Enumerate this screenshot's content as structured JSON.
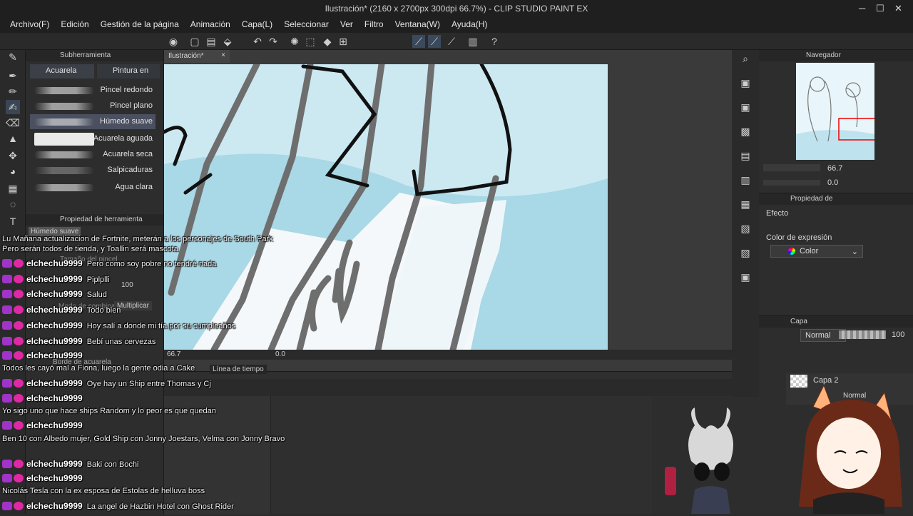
{
  "window": {
    "title": "Ilustración* (2160 x 2700px 300dpi 66.7%)  - CLIP STUDIO PAINT EX",
    "minimize": "─",
    "maximize": "☐",
    "close": "✕"
  },
  "menu": [
    "Archivo(F)",
    "Edición",
    "Gestión de la página",
    "Animación",
    "Capa(L)",
    "Seleccionar",
    "Ver",
    "Filtro",
    "Ventana(W)",
    "Ayuda(H)"
  ],
  "subtool": {
    "header": "Subherramienta",
    "tabs": [
      "Acuarela",
      "Pintura en"
    ],
    "brushes": [
      {
        "label": "Pincel redondo",
        "selected": false
      },
      {
        "label": "Pincel plano",
        "selected": false
      },
      {
        "label": "Húmedo suave",
        "selected": true
      },
      {
        "label": "Acuarela aguada",
        "selected": false
      },
      {
        "label": "Acuarela seca",
        "selected": false
      },
      {
        "label": "Salpicaduras",
        "selected": false
      },
      {
        "label": "Agua clara",
        "selected": false
      }
    ],
    "tool_property_header": "Propiedad de herramienta",
    "tool_property_name": "Húmedo suave",
    "brush_size_label": "Tamaño del pincel",
    "opacity_value": "100",
    "blend_mode_label": "Modo de combinación",
    "blend_mode_value": "Multiplicar",
    "border_label": "Borde de acuarela"
  },
  "document": {
    "tab_label": "Ilustración*",
    "tab_close": "×",
    "zoom": "66.7",
    "rotation": "0.0"
  },
  "timeline": {
    "label": "Línea de tiempo"
  },
  "navigator": {
    "header": "Navegador",
    "zoom": "66.7",
    "rotation": "0.0"
  },
  "property": {
    "header": "Propiedad de",
    "effect_label": "Efecto",
    "expression_color_label": "Color de expresión",
    "expression_color_value": "Color"
  },
  "layers": {
    "header": "Capa",
    "blend": "Normal",
    "opacity": "100",
    "items": [
      {
        "name": "Capa 2",
        "mode": ""
      },
      {
        "name": "",
        "mode": "Normal"
      }
    ]
  },
  "chat": [
    {
      "user": "",
      "text": "Lu Mañana actualizacion de Fortnite, meterán a los personajes de South Park Pero serán todos de tienda, y Toallin será mascota",
      "wrap": true
    },
    {
      "user": "elchechu9999",
      "text": "Pero como soy pobre no tendré nada"
    },
    {
      "user": "elchechu9999",
      "text": "Piplplli"
    },
    {
      "user": "elchechu9999",
      "text": "Salud"
    },
    {
      "user": "elchechu9999",
      "text": "Todo bien"
    },
    {
      "user": "elchechu9999",
      "text": "Hoy salí a donde mi tía por su cumpleaños"
    },
    {
      "user": "elchechu9999",
      "text": "Bebí unas cervezas"
    },
    {
      "user": "elchechu9999",
      "text": ""
    },
    {
      "user": "",
      "text": "Todos les cayó mal a Fiona, luego la gente odia a Cake"
    },
    {
      "user": "elchechu9999",
      "text": "Oye hay un Ship entre Thomas y Cj"
    },
    {
      "user": "elchechu9999",
      "text": ""
    },
    {
      "user": "",
      "text": "Yo sigo uno que hace ships Random y lo peor es que quedan"
    },
    {
      "user": "elchechu9999",
      "text": ""
    },
    {
      "user": "",
      "text": "Ben 10 con Albedo mujer, Gold Ship con Jonny Joestars, Velma con Jonny Bravo",
      "wrap": true
    },
    {
      "user": "elchechu9999",
      "text": "Baki con Bochi"
    },
    {
      "user": "elchechu9999",
      "text": ""
    },
    {
      "user": "",
      "text": "Nicolás Tesla con la ex esposa de Estolas de helluva boss"
    },
    {
      "user": "elchechu9999",
      "text": "La angel de Hazbin Hotel con Ghost Rider"
    }
  ]
}
